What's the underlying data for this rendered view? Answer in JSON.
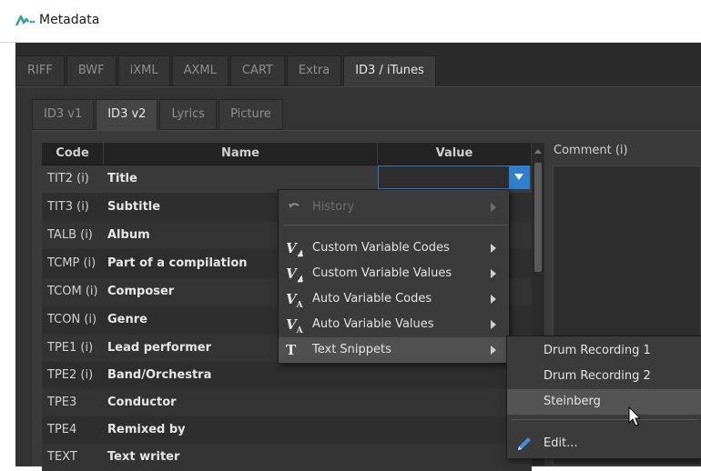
{
  "window": {
    "title": "Metadata"
  },
  "colors": {
    "accent": "#2f7fcf",
    "background": "#2b2b2b"
  },
  "main_tabs": [
    {
      "label": "RIFF",
      "active": false
    },
    {
      "label": "BWF",
      "active": false
    },
    {
      "label": "iXML",
      "active": false
    },
    {
      "label": "AXML",
      "active": false
    },
    {
      "label": "CART",
      "active": false
    },
    {
      "label": "Extra",
      "active": false
    },
    {
      "label": "ID3 / iTunes",
      "active": true
    }
  ],
  "sub_tabs": [
    {
      "label": "ID3 v1",
      "active": false
    },
    {
      "label": "ID3 v2",
      "active": true
    },
    {
      "label": "Lyrics",
      "active": false
    },
    {
      "label": "Picture",
      "active": false
    }
  ],
  "table": {
    "columns": {
      "code": "Code",
      "name": "Name",
      "value": "Value"
    },
    "rows": [
      {
        "code": "TIT2 (i)",
        "name": "Title"
      },
      {
        "code": "TIT3 (i)",
        "name": "Subtitle"
      },
      {
        "code": "TALB (i)",
        "name": "Album"
      },
      {
        "code": "TCMP (i)",
        "name": "Part of a compilation"
      },
      {
        "code": "TCOM (i)",
        "name": "Composer"
      },
      {
        "code": "TCON (i)",
        "name": "Genre"
      },
      {
        "code": "TPE1 (i)",
        "name": "Lead performer"
      },
      {
        "code": "TPE2 (i)",
        "name": "Band/Orchestra"
      },
      {
        "code": "TPE3",
        "name": "Conductor"
      },
      {
        "code": "TPE4",
        "name": "Remixed by"
      },
      {
        "code": "TEXT",
        "name": "Text writer"
      }
    ]
  },
  "comment": {
    "label": "Comment (i)"
  },
  "context_menu": {
    "items": [
      {
        "label": "History",
        "icon": "undo-icon",
        "disabled": true
      },
      {
        "label": "Custom Variable Codes",
        "icon": "custom-variable-icon"
      },
      {
        "label": "Custom Variable Values",
        "icon": "custom-variable-icon"
      },
      {
        "label": "Auto Variable Codes",
        "icon": "auto-variable-icon"
      },
      {
        "label": "Auto Variable Values",
        "icon": "auto-variable-icon"
      },
      {
        "label": "Text Snippets",
        "icon": "text-icon",
        "highlighted": true
      }
    ]
  },
  "submenu": {
    "items": [
      {
        "label": "Drum Recording 1"
      },
      {
        "label": "Drum Recording 2"
      },
      {
        "label": "Steinberg",
        "highlighted": true
      },
      {
        "label": "Edit...",
        "icon": "pencil-icon"
      }
    ]
  }
}
